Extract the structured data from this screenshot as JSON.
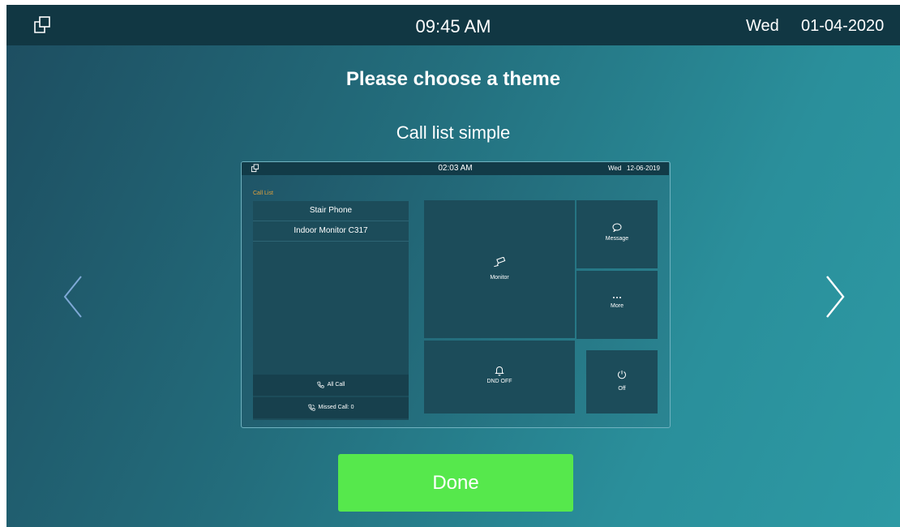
{
  "status_bar": {
    "icon": "windows-icon",
    "time": "09:45 AM",
    "day": "Wed",
    "date": "01-04-2020"
  },
  "title": "Please choose a theme",
  "theme_name": "Call list simple",
  "nav": {
    "prev_icon": "chevron-left-icon",
    "next_icon": "chevron-right-icon"
  },
  "preview": {
    "status_bar": {
      "time": "02:03 AM",
      "day": "Wed",
      "date": "12-06-2019"
    },
    "call_list_label": "Call List",
    "contacts": [
      "Stair Phone",
      "Indoor Monitor C317"
    ],
    "all_call_label": "All Call",
    "missed_call_label": "Missed Call: 0",
    "tiles": {
      "monitor": "Monitor",
      "message": "Message",
      "more": "More",
      "dnd": "DND OFF",
      "off": "Off"
    }
  },
  "done_label": "Done",
  "colors": {
    "status_bar_bg": "#113743",
    "accent_done": "#56e84c",
    "call_list_label": "#e3a23b"
  }
}
